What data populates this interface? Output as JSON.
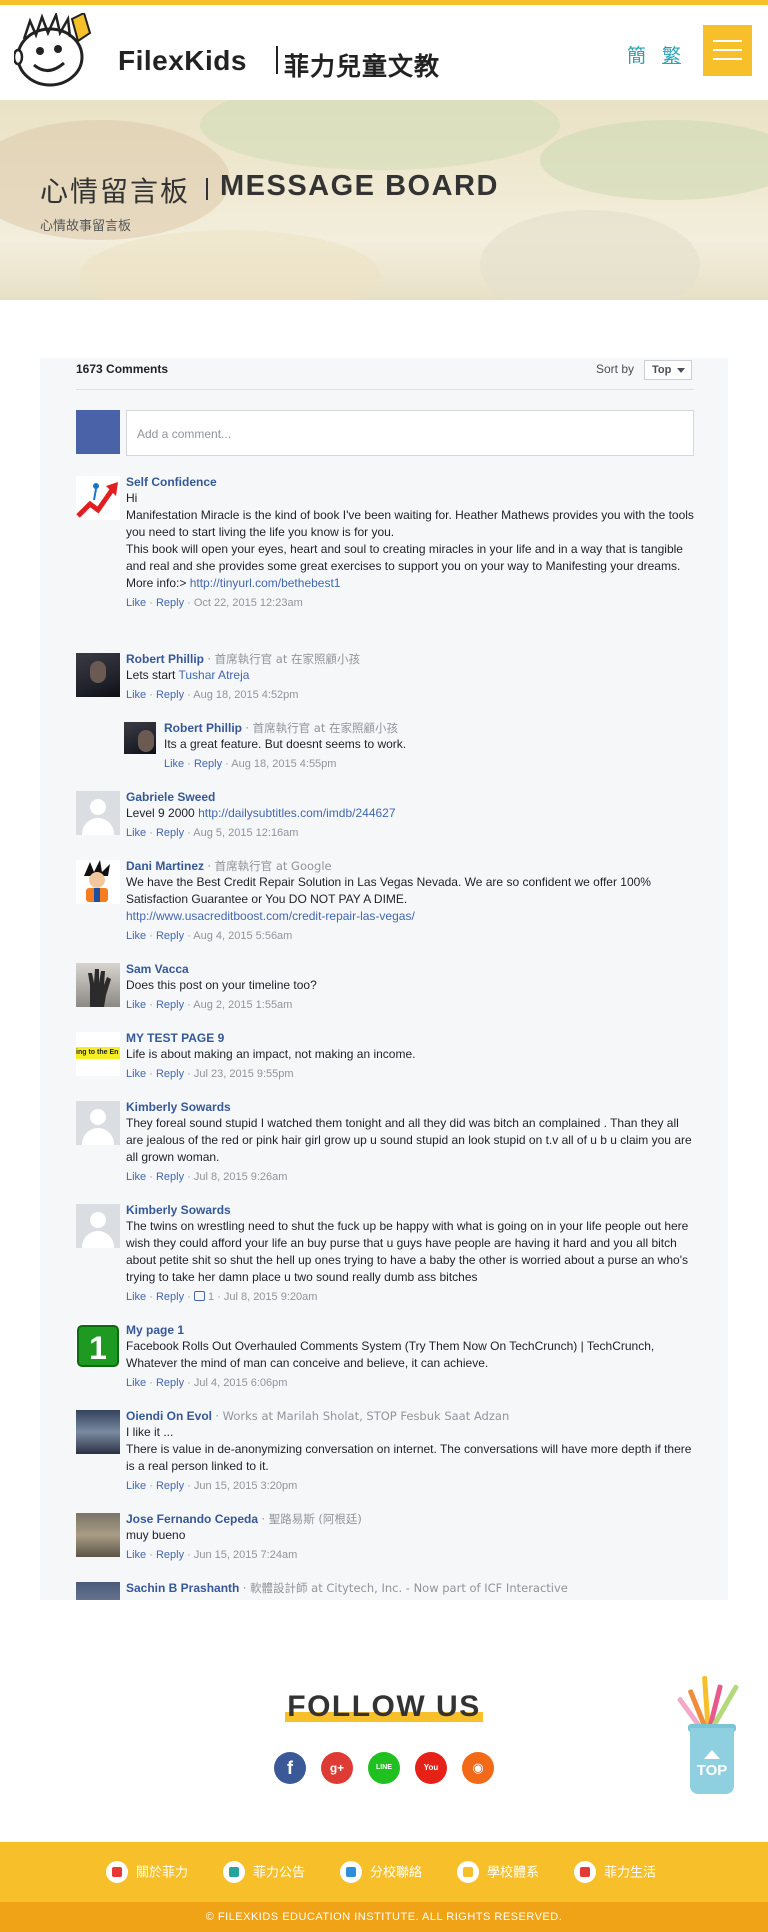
{
  "header": {
    "brand_en": "FilexKids",
    "brand_cn": "菲力兒童文教",
    "lang_simplified": "簡",
    "lang_traditional": "繁"
  },
  "banner": {
    "title_cn": "心情留言板",
    "title_en": "MESSAGE BOARD",
    "subtitle": "心情故事留言板"
  },
  "comments_plugin": {
    "count_label": "1673 Comments",
    "sort_label": "Sort by",
    "sort_value": "Top",
    "composer_placeholder": "Add a comment...",
    "comments": [
      {
        "name": "Self Confidence",
        "meta": "",
        "lines": [
          "Hi",
          "Manifestation Miracle is the kind of book I've been waiting for. Heather Mathews provides you with the tools you need to start living the life you know is for you.",
          "This book will open your eyes, heart and soul to creating miracles in your life and in a way that is tangible and real and she provides some great exercises to support you on your way to Manifesting your dreams."
        ],
        "prefix": "More info:>",
        "link": "http://tinyurl.com/bethebest1",
        "suffix": "",
        "like": "Like",
        "reply": "Reply",
        "likes": "",
        "date": "Oct 22, 2015 12:23am"
      },
      {
        "name": "Robert Phillip",
        "meta": "首席執行官 at 在家照顧小孩",
        "lines": [],
        "prefix": "Lets start",
        "link": "Tushar Atreja",
        "suffix": "",
        "like": "Like",
        "reply": "Reply",
        "likes": "",
        "date": "Aug 18, 2015 4:52pm"
      },
      {
        "name": "Robert Phillip",
        "meta": "首席執行官 at 在家照顧小孩",
        "lines": [
          "Its a great feature. But doesnt seems to work."
        ],
        "prefix": "",
        "link": "",
        "suffix": "",
        "like": "Like",
        "reply": "Reply",
        "likes": "",
        "date": "Aug 18, 2015 4:55pm"
      },
      {
        "name": "Gabriele Sweed",
        "meta": "",
        "lines": [],
        "prefix": "Level 9 2000",
        "link": "http://dailysubtitles.com/imdb/244627",
        "suffix": "",
        "like": "Like",
        "reply": "Reply",
        "likes": "",
        "date": "Aug 5, 2015 12:16am"
      },
      {
        "name": "Dani Martinez",
        "meta": "首席執行官 at Google",
        "lines": [
          "We have the Best Credit Repair Solution in Las Vegas Nevada. We are so confident we offer 100% Satisfaction Guarantee or You DO NOT PAY A DIME."
        ],
        "prefix": "",
        "link": "http://www.usacreditboost.com/credit-repair-las-vegas/",
        "suffix": "",
        "like": "Like",
        "reply": "Reply",
        "likes": "",
        "date": "Aug 4, 2015 5:56am"
      },
      {
        "name": "Sam Vacca",
        "meta": "",
        "lines": [
          "Does this post on your timeline too?"
        ],
        "prefix": "",
        "link": "",
        "suffix": "",
        "like": "Like",
        "reply": "Reply",
        "likes": "",
        "date": "Aug 2, 2015 1:55am"
      },
      {
        "name": "MY TEST PAGE 9",
        "meta": "",
        "avatar_text": "ing to the En",
        "lines": [
          "Life is about making an impact, not making an income."
        ],
        "prefix": "",
        "link": "",
        "suffix": "",
        "like": "Like",
        "reply": "Reply",
        "likes": "",
        "date": "Jul 23, 2015 9:55pm"
      },
      {
        "name": "Kimberly Sowards",
        "meta": "",
        "lines": [
          "They foreal sound stupid I watched them tonight and all they did was bitch an complained . Than they all are jealous of the red or pink hair girl grow up u sound stupid an look stupid on t.v all of u b u claim you are all grown woman."
        ],
        "prefix": "",
        "link": "",
        "suffix": "",
        "like": "Like",
        "reply": "Reply",
        "likes": "",
        "date": "Jul 8, 2015 9:26am"
      },
      {
        "name": "Kimberly Sowards",
        "meta": "",
        "lines": [
          "The twins on wrestling need to shut the fuck up be happy with what is going on in your life people out here wish they could afford your life an buy purse that u guys have people are having it hard and you all bitch about petite shit so shut the hell up ones trying to have a baby the other is worried about a purse an who's trying to take her damn place u two sound really dumb ass bitches"
        ],
        "prefix": "",
        "link": "",
        "suffix": "",
        "like": "Like",
        "reply": "Reply",
        "likes": "1",
        "date": "Jul 8, 2015 9:20am"
      },
      {
        "name": "My page 1",
        "meta": "",
        "avatar_text": "1",
        "lines": [
          "Facebook Rolls Out Overhauled Comments System (Try Them Now On TechCrunch) | TechCrunch, Whatever the mind of man can conceive and believe, it can achieve."
        ],
        "prefix": "",
        "link": "",
        "suffix": "",
        "like": "Like",
        "reply": "Reply",
        "likes": "",
        "date": "Jul 4, 2015 6:06pm"
      },
      {
        "name": "Oiendi On Evol",
        "meta": "Works at Marilah Sholat, STOP Fesbuk Saat Adzan",
        "lines": [
          "I like it ...",
          "There is value in de-anonymizing conversation on internet. The conversations will have more depth if there is a real person linked to it."
        ],
        "prefix": "",
        "link": "",
        "suffix": "",
        "like": "Like",
        "reply": "Reply",
        "likes": "",
        "date": "Jun 15, 2015 3:20pm"
      },
      {
        "name": "Jose Fernando Cepeda",
        "meta": "聖路易斯 (阿根廷)",
        "lines": [
          "muy bueno"
        ],
        "prefix": "",
        "link": "",
        "suffix": "",
        "like": "Like",
        "reply": "Reply",
        "likes": "",
        "date": "Jun 15, 2015 7:24am"
      },
      {
        "name": "Sachin B Prashanth",
        "meta": "軟體設計師 at Citytech, Inc. - Now part of ICF Interactive",
        "lines": [],
        "prefix": "",
        "link": "",
        "suffix": "",
        "like": "",
        "reply": "",
        "likes": "",
        "date": ""
      }
    ]
  },
  "follow": {
    "title": "FOLLOW US",
    "icons": [
      "facebook-icon",
      "google-plus-icon",
      "line-icon",
      "youtube-icon",
      "weibo-icon"
    ],
    "gplus_glyph": "g+",
    "line_glyph": "LINE",
    "youtube_glyph": "You Tube"
  },
  "top_button": {
    "label": "TOP"
  },
  "footer": {
    "nav": [
      {
        "label": "關於菲力",
        "icon": "flag-icon",
        "color": "#e53935"
      },
      {
        "label": "菲力公告",
        "icon": "megaphone-icon",
        "color": "#26a69a"
      },
      {
        "label": "分校聯絡",
        "icon": "mail-icon",
        "color": "#2d8fd5"
      },
      {
        "label": "學校體系",
        "icon": "books-icon",
        "color": "#f7c02a"
      },
      {
        "label": "菲力生活",
        "icon": "heart-icon",
        "color": "#e53935"
      }
    ],
    "copyright": "© FILEXKIDS EDUCATION INSTITUTE. ALL RIGHTS RESERVED."
  },
  "colors": {
    "brand_yellow": "#f7c02a",
    "facebook_link": "#4267b2",
    "facebook_name": "#365899",
    "lang_teal": "#2aa3b5"
  }
}
